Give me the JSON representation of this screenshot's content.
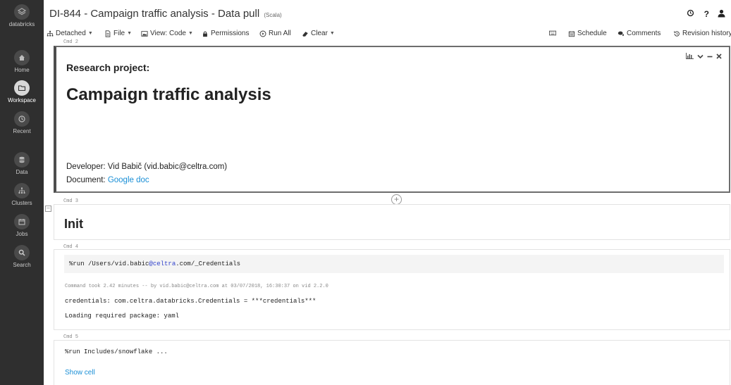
{
  "sidebar": {
    "brand": "databricks",
    "items": [
      {
        "label": "Home",
        "icon": "home-icon"
      },
      {
        "label": "Workspace",
        "icon": "folder-icon",
        "active": true
      },
      {
        "label": "Recent",
        "icon": "clock-icon"
      },
      {
        "label": "Data",
        "icon": "database-icon"
      },
      {
        "label": "Clusters",
        "icon": "clusters-icon"
      },
      {
        "label": "Jobs",
        "icon": "calendar-icon"
      },
      {
        "label": "Search",
        "icon": "search-icon"
      }
    ]
  },
  "header": {
    "title": "DI-844 - Campaign traffic analysis - Data pull",
    "language": "(Scala)"
  },
  "toolbar": {
    "detached": "Detached",
    "file": "File",
    "view": "View: Code",
    "permissions": "Permissions",
    "run_all": "Run All",
    "clear": "Clear",
    "schedule": "Schedule",
    "comments": "Comments",
    "revision_history": "Revision history"
  },
  "cells": {
    "cmd2": {
      "label": "Cmd 2",
      "subtitle": "Research project:",
      "title": "Campaign traffic analysis",
      "developer": "Developer: Vid Babič (vid.babic@celtra.com)",
      "document_prefix": "Document: ",
      "document_link": "Google doc"
    },
    "cmd3": {
      "label": "Cmd 3",
      "title": "Init"
    },
    "cmd4": {
      "label": "Cmd 4",
      "code_prefix": "%run /Users/vid.babic",
      "code_kw": "@celtra",
      "code_suffix": ".com/_Credentials",
      "meta": "Command took 2.42 minutes -- by vid.babic@celtra.com at 03/07/2018, 16:30:37 on vid 2.2.0",
      "output1": "credentials: com.celtra.databricks.Credentials = ***credentials***",
      "output2": "Loading required package: yaml"
    },
    "cmd5": {
      "label": "Cmd 5",
      "code": "%run Includes/snowflake ...",
      "show_cell": "Show cell"
    }
  },
  "colors": {
    "sidebar_bg": "#2f2f2f",
    "link": "#1a8fd6"
  }
}
